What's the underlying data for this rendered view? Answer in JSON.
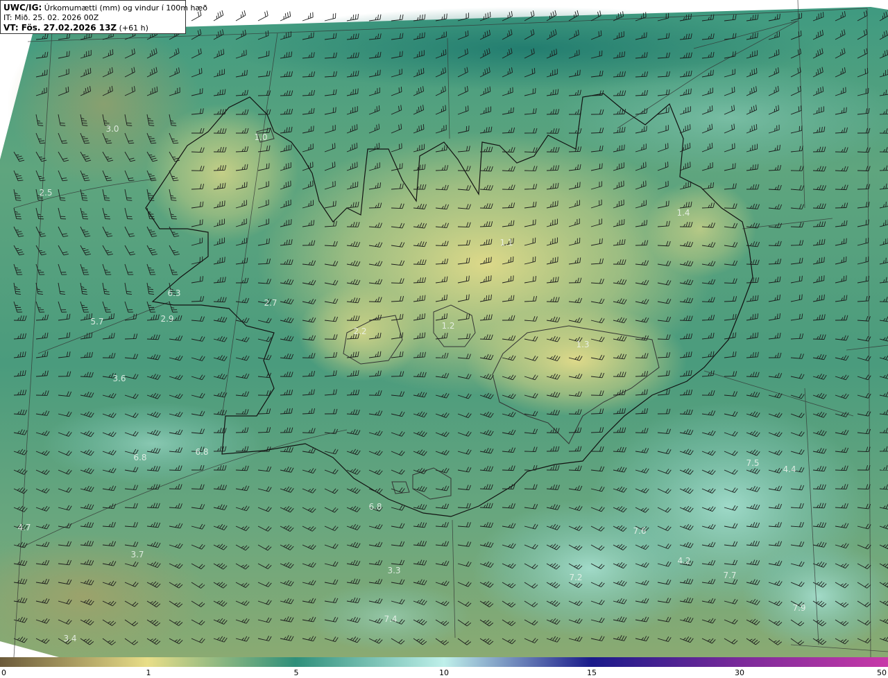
{
  "header": {
    "product": "UWC/IG:",
    "title": "Úrkomumætti (mm) og vindur í 100m hæð",
    "init_time": "IT: Mið. 25. 02. 2026 00Z",
    "valid_prefix": "VT: Fös. 27.02.2026 13Z",
    "valid_suffix": "(+61 h)"
  },
  "colors": {
    "dry": "#6b5a3a",
    "low": "#e8de88",
    "mid": "#2f8f7a",
    "high": "#bff0ea",
    "deep": "#1a1a8a",
    "max": "#c83aa8",
    "coast": "#111111",
    "barb": "#1a1a1a"
  },
  "colorbar": {
    "ticks": [
      "0",
      "1",
      "5",
      "10",
      "15",
      "30",
      "50"
    ]
  },
  "value_labels": [
    {
      "text": "3.0"
    },
    {
      "text": "2.5"
    },
    {
      "text": "6.3"
    },
    {
      "text": "5.7"
    },
    {
      "text": "2.9"
    },
    {
      "text": "2.7"
    },
    {
      "text": "2.2"
    },
    {
      "text": "3.6"
    },
    {
      "text": "6.8"
    },
    {
      "text": "6.8"
    },
    {
      "text": "6.8"
    },
    {
      "text": "4.7"
    },
    {
      "text": "3.7"
    },
    {
      "text": "3.3"
    },
    {
      "text": "7.4"
    },
    {
      "text": "3.4"
    },
    {
      "text": "7.2"
    },
    {
      "text": "7.6"
    },
    {
      "text": "4.2"
    },
    {
      "text": "7.7"
    },
    {
      "text": "7.9"
    },
    {
      "text": "7.5"
    },
    {
      "text": "4.4"
    },
    {
      "text": "1.1"
    },
    {
      "text": "1.2"
    },
    {
      "text": "1.3"
    },
    {
      "text": "1.4"
    },
    {
      "text": "1.0"
    }
  ],
  "icons": {
    "wind_barb": "wind-barb-icon"
  }
}
